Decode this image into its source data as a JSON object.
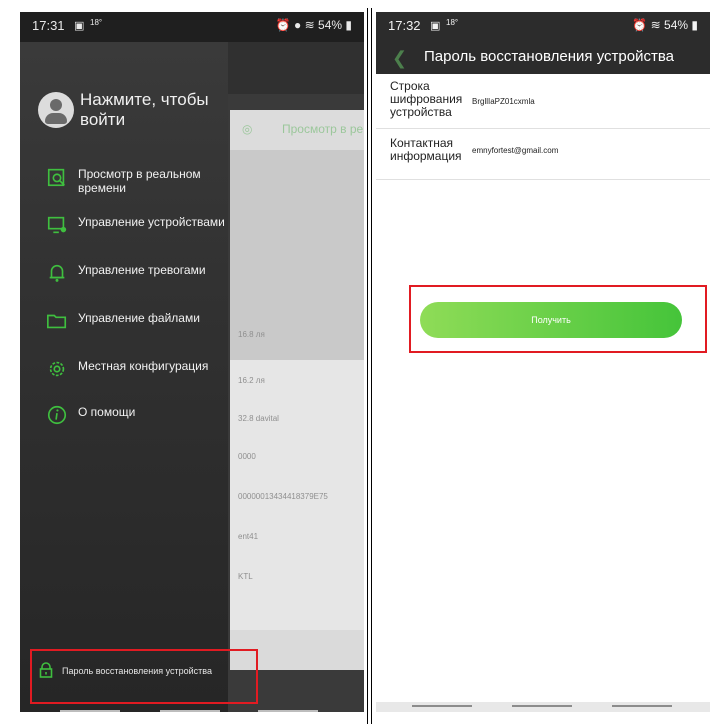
{
  "left": {
    "status": {
      "time": "17:31",
      "temp": "18°",
      "battery": "54%"
    },
    "login_text": "Нажмите, чтобы войти",
    "menu": [
      {
        "label": "Просмотр в реальном времени",
        "icon": "camera-view-icon"
      },
      {
        "label": "Управление устройствами",
        "icon": "device-monitor-icon"
      },
      {
        "label": "Управление тревогами",
        "icon": "bell-icon"
      },
      {
        "label": "Управление файлами",
        "icon": "folder-icon"
      },
      {
        "label": "Местная конфигурация",
        "icon": "gear-icon"
      },
      {
        "label": "О помощи",
        "icon": "info-icon"
      }
    ],
    "recovery_label": "Пароль восстановления устройства",
    "background_app": {
      "header": "Просмотр в ре",
      "lines": [
        "16.8 ля",
        "16.2 ля",
        "32.8 davital",
        "0000",
        "00000013434418379E75",
        "ent41",
        "KTL"
      ]
    }
  },
  "right": {
    "status": {
      "time": "17:32",
      "temp": "18°",
      "battery": "54%"
    },
    "title": "Пароль восстановления устройства",
    "rows": [
      {
        "label": "Строка шифрования устройства",
        "value": "BrgllIaPZ01cxmla"
      },
      {
        "label": "Контактная информация",
        "value": "emnyfortest@gmail.com"
      }
    ],
    "button_label": "Получить"
  },
  "colors": {
    "accent_green": "#45c43a",
    "highlight_red": "#e11b22",
    "drawer_bg": "#2b2b2b"
  }
}
